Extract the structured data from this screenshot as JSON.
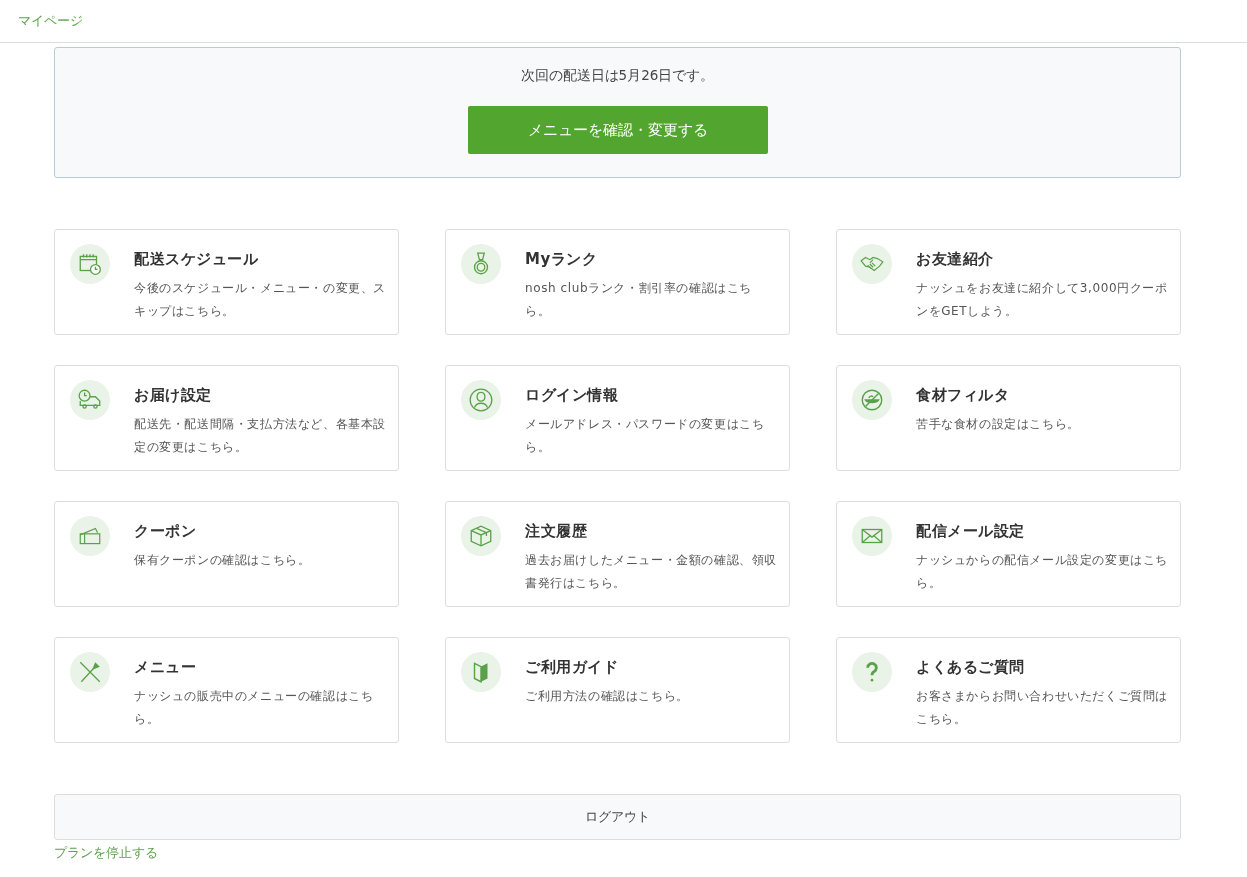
{
  "header": {
    "breadcrumb": "マイページ"
  },
  "delivery_banner": {
    "message": "次回の配送日は5月26日です。",
    "button": "メニューを確認・変更する"
  },
  "cards": [
    {
      "title": "配送スケジュール",
      "description": "今後のスケジュール・メニュー・の変更、スキップはこちら。"
    },
    {
      "title": "Myランク",
      "description": "nosh clubランク・割引率の確認はこちら。"
    },
    {
      "title": "お友達紹介",
      "description": "ナッシュをお友達に紹介して3,000円クーポンをGETしよう。"
    },
    {
      "title": "お届け設定",
      "description": "配送先・配送間隔・支払方法など、各基本設定の変更はこちら。"
    },
    {
      "title": "ログイン情報",
      "description": "メールアドレス・パスワードの変更はこちら。"
    },
    {
      "title": "食材フィルタ",
      "description": "苦手な食材の設定はこちら。"
    },
    {
      "title": "クーポン",
      "description": "保有クーポンの確認はこちら。"
    },
    {
      "title": "注文履歴",
      "description": "過去お届けしたメニュー・金額の確認、領収書発行はこちら。"
    },
    {
      "title": "配信メール設定",
      "description": "ナッシュからの配信メール設定の変更はこちら。"
    },
    {
      "title": "メニュー",
      "description": "ナッシュの販売中のメニューの確認はこちら。"
    },
    {
      "title": "ご利用ガイド",
      "description": "ご利用方法の確認はこちら。"
    },
    {
      "title": "よくあるご質問",
      "description": "お客さまからお問い合わせいただくご質問はこちら。"
    }
  ],
  "logout_button": "ログアウト",
  "stop_plan_link": "プランを停止する"
}
